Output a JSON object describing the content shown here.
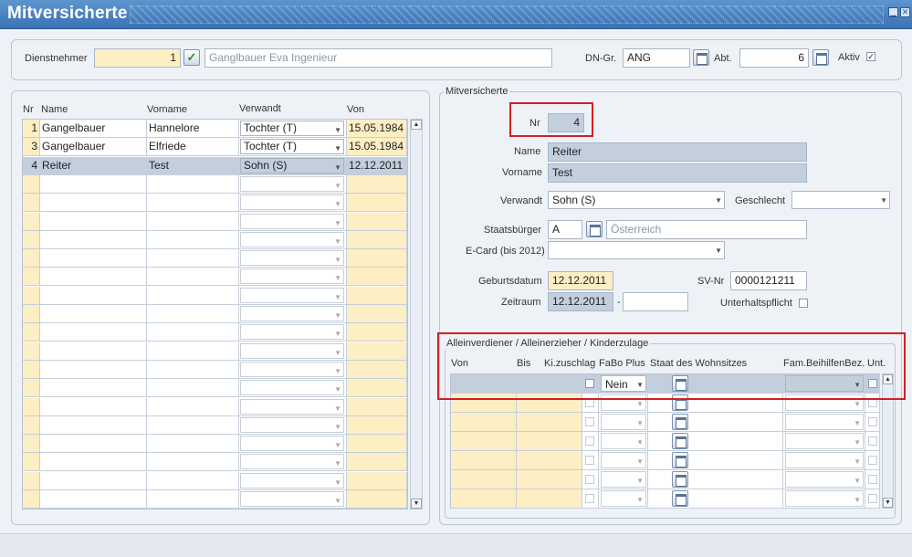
{
  "window": {
    "title": "Mitversicherte"
  },
  "header": {
    "dienstnehmer_label": "Dienstnehmer",
    "dienstnehmer_value": "1",
    "dienstnehmer_name": "Ganglbauer Eva Ingenieur",
    "dngr_label": "DN-Gr.",
    "dngr_value": "ANG",
    "abt_label": "Abt.",
    "abt_value": "6",
    "aktiv_label": "Aktiv",
    "aktiv_checked": "✓"
  },
  "list": {
    "columns": {
      "nr": "Nr",
      "name": "Name",
      "vorname": "Vorname",
      "verwandt": "Verwandt",
      "von": "Von"
    },
    "rows": [
      {
        "nr": "1",
        "name": "Gangelbauer",
        "vorname": "Hannelore",
        "verwandt": "Tochter (T)",
        "von": "15.05.1984"
      },
      {
        "nr": "3",
        "name": "Gangelbauer",
        "vorname": "Elfriede",
        "verwandt": "Tochter (T)",
        "von": "15.05.1984"
      },
      {
        "nr": "4",
        "name": "Reiter",
        "vorname": "Test",
        "verwandt": "Sohn (S)",
        "von": "12.12.2011"
      }
    ],
    "empty_rows": 18
  },
  "detail": {
    "group_label": "Mitversicherte",
    "nr_label": "Nr",
    "nr_value": "4",
    "name_label": "Name",
    "name_value": "Reiter",
    "vorname_label": "Vorname",
    "vorname_value": "Test",
    "verwandt_label": "Verwandt",
    "verwandt_value": "Sohn (S)",
    "geschlecht_label": "Geschlecht",
    "geschlecht_value": "",
    "staatsbuerger_label": "Staatsbürger",
    "staatsbuerger_code": "A",
    "staatsbuerger_name": "Österreich",
    "ecard_label": "E-Card (bis 2012)",
    "ecard_value": "",
    "geburtsdatum_label": "Geburtsdatum",
    "geburtsdatum_value": "12.12.2011",
    "svnr_label": "SV-Nr",
    "svnr_value": "0000121211",
    "zeitraum_label": "Zeitraum",
    "zeitraum_von": "12.12.2011",
    "zeitraum_sep": "-",
    "zeitraum_bis": "",
    "unterhalt_label": "Unterhaltspflicht"
  },
  "allein": {
    "group_label": "Alleinverdiener / Alleinerzieher / Kinderzulage",
    "columns": {
      "von": "Von",
      "bis": "Bis",
      "kizuschlag": "Ki.zuschlag",
      "fabo": "FaBo Plus",
      "staat": "Staat des Wohnsitzes",
      "fam": "Fam.BeihilfenBez.",
      "unt": "Unt."
    },
    "first_row_fabo": "Nein",
    "empty_rows": 6
  }
}
